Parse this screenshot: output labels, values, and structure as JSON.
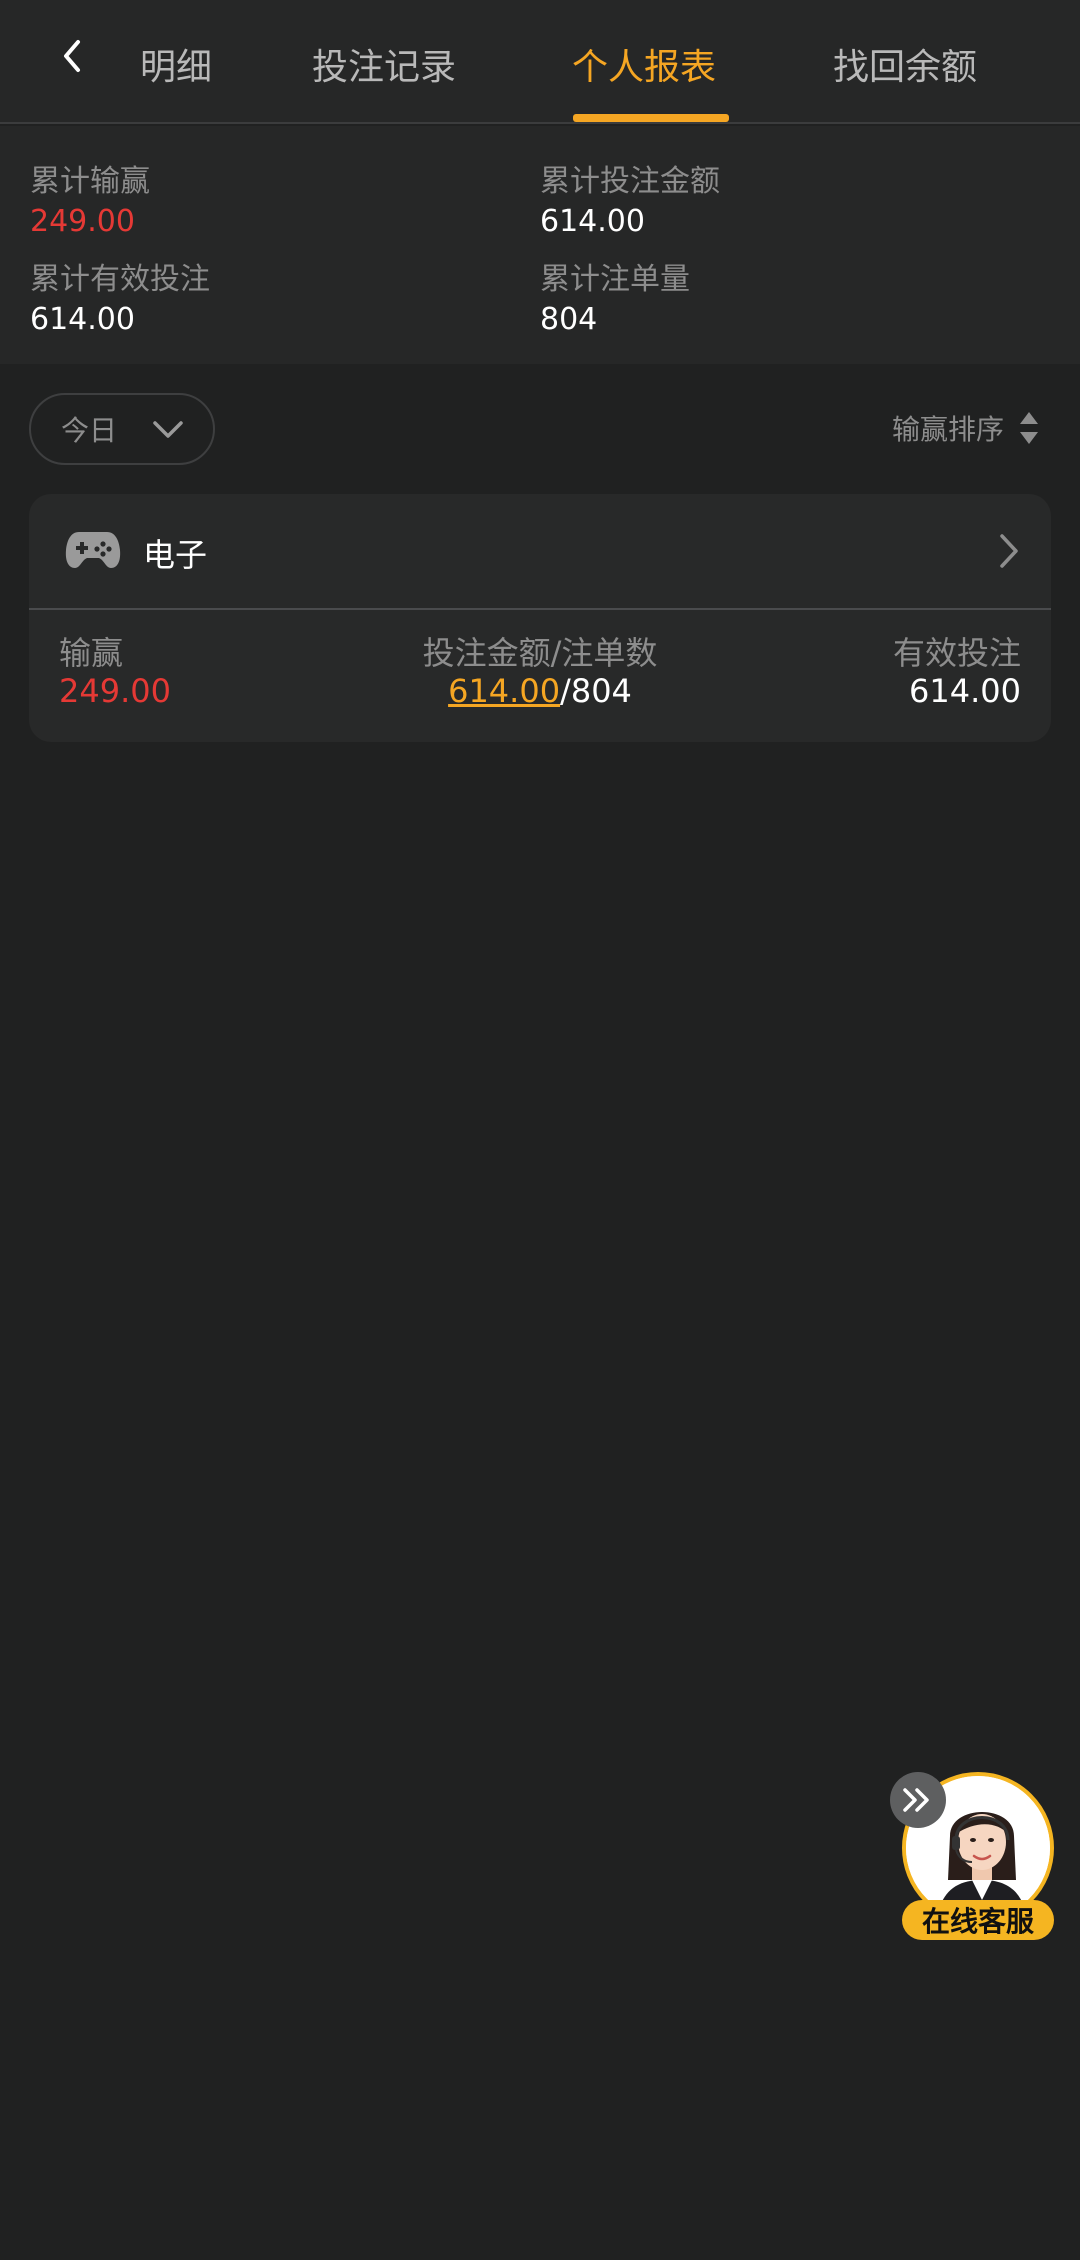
{
  "header": {
    "tabs": [
      {
        "label": "明细"
      },
      {
        "label": "投注记录"
      },
      {
        "label": "个人报表",
        "active": true
      },
      {
        "label": "找回余额"
      }
    ]
  },
  "summary": {
    "total_win_loss": {
      "label": "累计输赢",
      "value": "249.00"
    },
    "total_bet_amount": {
      "label": "累计投注金额",
      "value": "614.00"
    },
    "total_valid_bet": {
      "label": "累计有效投注",
      "value": "614.00"
    },
    "total_orders": {
      "label": "累计注单量",
      "value": "804"
    }
  },
  "filters": {
    "date_range": "今日",
    "sort_label": "输赢排序"
  },
  "card": {
    "title": "电子",
    "win_loss_label": "输赢",
    "win_loss_value": "249.00",
    "amount_label": "投注金额/注单数",
    "amount_value": "614.00",
    "separator": "/",
    "order_count": "804",
    "valid_label": "有效投注",
    "valid_value": "614.00"
  },
  "support": {
    "label": "在线客服"
  },
  "colors": {
    "accent": "#f5a623",
    "negative": "#e53935",
    "background": "#202121"
  }
}
